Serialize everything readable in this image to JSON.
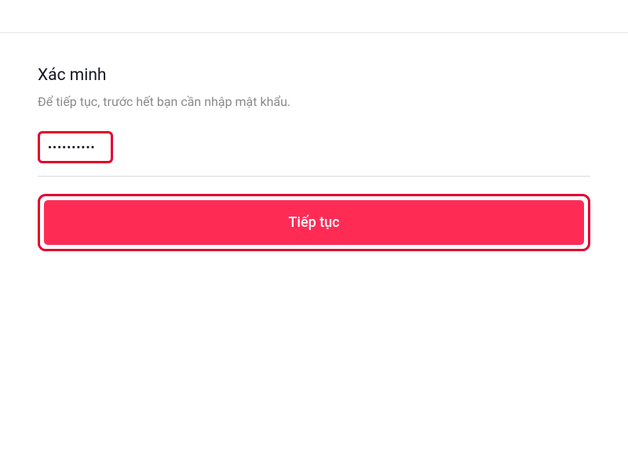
{
  "verify": {
    "title": "Xác minh",
    "subtitle": "Để tiếp tục, trước hết bạn cần nhập mật khẩu.",
    "password_value": "••••••••••",
    "continue_label": "Tiếp tục"
  }
}
